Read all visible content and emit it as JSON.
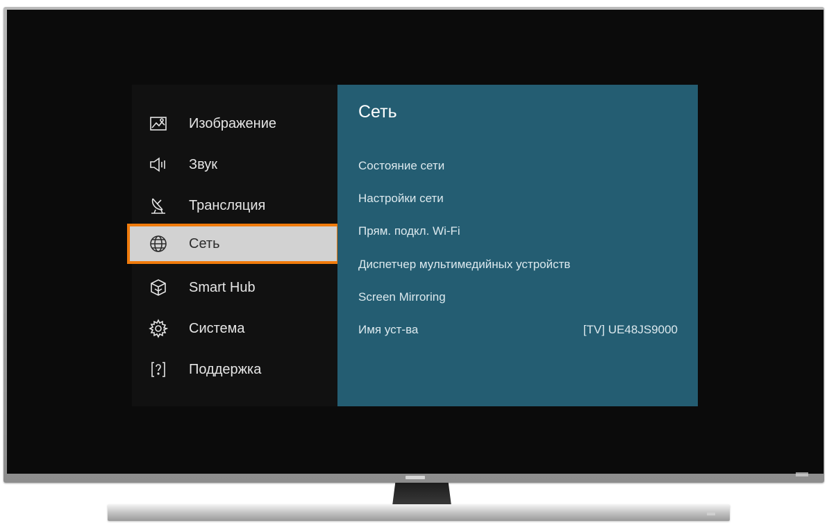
{
  "menu": {
    "items": [
      {
        "label": "Изображение",
        "icon": "picture-icon"
      },
      {
        "label": "Звук",
        "icon": "speaker-icon"
      },
      {
        "label": "Трансляция",
        "icon": "satellite-dish-icon"
      },
      {
        "label": "Сеть",
        "icon": "globe-icon",
        "selected": true
      },
      {
        "label": "Smart Hub",
        "icon": "smart-hub-cube-icon"
      },
      {
        "label": "Система",
        "icon": "gear-icon"
      },
      {
        "label": "Поддержка",
        "icon": "help-icon"
      }
    ]
  },
  "network": {
    "title": "Сеть",
    "items": [
      {
        "label": "Состояние сети"
      },
      {
        "label": "Настройки сети"
      },
      {
        "label": "Прям. подкл. Wi-Fi"
      },
      {
        "label": "Диспетчер мультимедийных устройств"
      },
      {
        "label": "Screen Mirroring"
      },
      {
        "label": "Имя уст-ва",
        "value": "[TV] UE48JS9000"
      }
    ]
  },
  "colors": {
    "accent_focus": "#f07b0c",
    "panel_teal": "#245d72",
    "menu_bg": "#111111",
    "screen_bg": "#0b0b0b"
  }
}
